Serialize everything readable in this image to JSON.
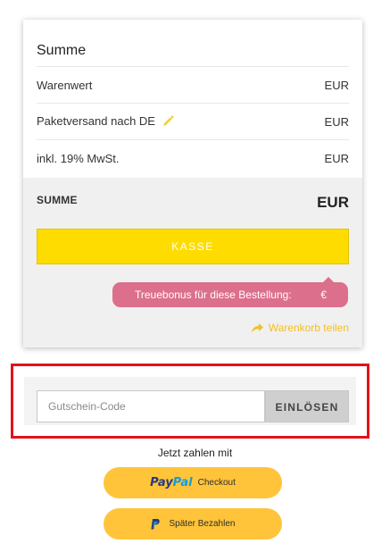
{
  "summary": {
    "title": "Summe",
    "rows": [
      {
        "label": "Warenwert",
        "value": "EUR"
      },
      {
        "label": "Paketversand nach DE",
        "value": "EUR",
        "editable": true
      },
      {
        "label": "inkl. 19% MwSt.",
        "value": "EUR"
      }
    ],
    "total_label": "SUMME",
    "total_value": "EUR",
    "checkout_label": "KASSE",
    "bonus_label": "Treuebonus für diese Bestellung:",
    "bonus_value": "€",
    "share_label": "Warenkorb teilen",
    "colors": {
      "checkout": "#ffdc00",
      "bonus": "#dc6f8c",
      "share": "#f3c024"
    }
  },
  "voucher": {
    "placeholder": "Gutschein-Code",
    "value": "",
    "redeem_label": "EINLÖSEN",
    "highlight_color": "#e3121c"
  },
  "payment": {
    "heading": "Jetzt zahlen mit",
    "paypal_checkout": {
      "logo_pay": "Pay",
      "logo_pal": "Pal",
      "label": "Checkout"
    },
    "paypal_later": {
      "label": "Später Bezahlen"
    },
    "button_color": "#ffc439"
  }
}
